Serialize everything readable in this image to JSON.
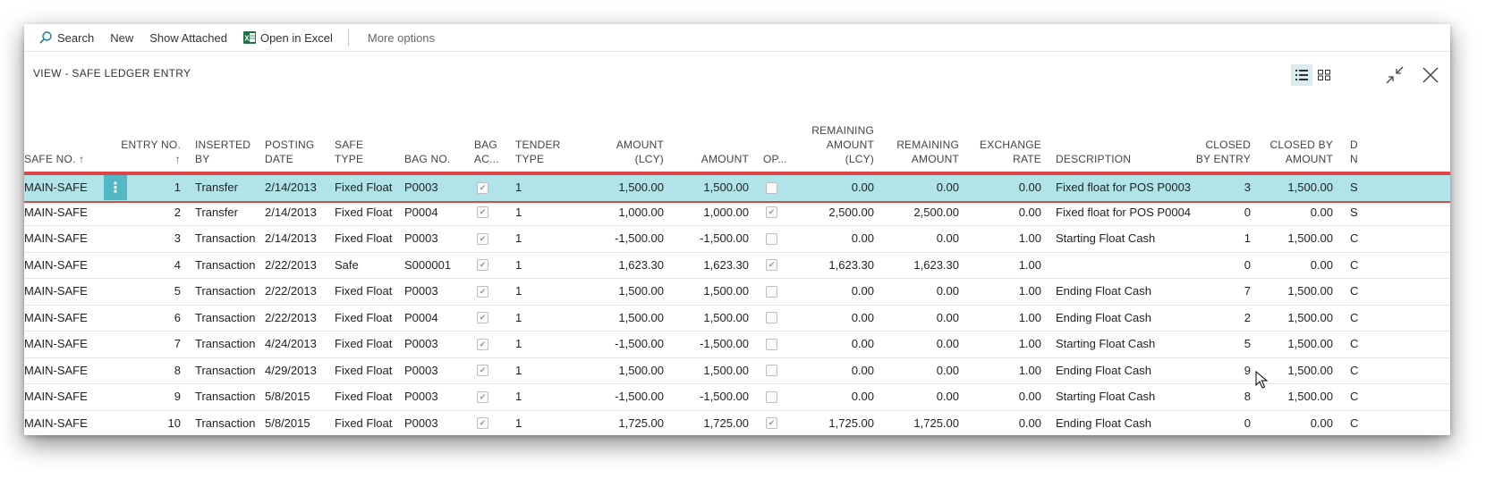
{
  "toolbar": {
    "search": "Search",
    "new": "New",
    "show_attached": "Show Attached",
    "open_in_excel": "Open in Excel",
    "more_options": "More options"
  },
  "view_title": "VIEW - SAFE LEDGER ENTRY",
  "columns": {
    "safe_no": [
      "SAFE NO. ↑"
    ],
    "entry_no": [
      "ENTRY NO.",
      "↑"
    ],
    "inserted_by": [
      "INSERTED",
      "BY"
    ],
    "posting_date": [
      "POSTING",
      "DATE"
    ],
    "safe_type": [
      "SAFE",
      "TYPE"
    ],
    "bag_no": [
      "BAG NO."
    ],
    "bag_ac": [
      "BAG",
      "AC..."
    ],
    "tender_type": [
      "TENDER",
      "TYPE"
    ],
    "amount_lcy": [
      "AMOUNT",
      "(LCY)"
    ],
    "amount": [
      "AMOUNT"
    ],
    "op": [
      "OP..."
    ],
    "remaining_amount_lcy": [
      "REMAINING",
      "AMOUNT",
      "(LCY)"
    ],
    "remaining_amount": [
      "REMAINING",
      "AMOUNT"
    ],
    "exchange_rate": [
      "EXCHANGE",
      "RATE"
    ],
    "description": [
      "DESCRIPTION"
    ],
    "closed_by_entry": [
      "CLOSED",
      "BY ENTRY"
    ],
    "closed_by_amount": [
      "CLOSED BY",
      "AMOUNT"
    ],
    "d_partial": [
      "D",
      "N"
    ]
  },
  "rows": [
    {
      "safe_no": "MAIN-SAFE",
      "entry_no": "1",
      "inserted_by": "Transfer",
      "posting_date": "2/14/2013",
      "safe_type": "Fixed Float",
      "bag_no": "P0003",
      "bag_ac": true,
      "tender_type": "1",
      "amount_lcy": "1,500.00",
      "amount": "1,500.00",
      "op": false,
      "remaining_amount_lcy": "0.00",
      "remaining_amount": "0.00",
      "exchange_rate": "0.00",
      "description": "Fixed float for POS P0003",
      "closed_by_entry": "3",
      "closed_by_amount": "1,500.00",
      "d_partial": "S",
      "selected": true
    },
    {
      "safe_no": "MAIN-SAFE",
      "entry_no": "2",
      "inserted_by": "Transfer",
      "posting_date": "2/14/2013",
      "safe_type": "Fixed Float",
      "bag_no": "P0004",
      "bag_ac": true,
      "tender_type": "1",
      "amount_lcy": "1,000.00",
      "amount": "1,000.00",
      "op": true,
      "remaining_amount_lcy": "2,500.00",
      "remaining_amount": "2,500.00",
      "exchange_rate": "0.00",
      "description": "Fixed float for POS P0004",
      "closed_by_entry": "0",
      "closed_by_amount": "0.00",
      "d_partial": "S"
    },
    {
      "safe_no": "MAIN-SAFE",
      "entry_no": "3",
      "inserted_by": "Transaction",
      "posting_date": "2/14/2013",
      "safe_type": "Fixed Float",
      "bag_no": "P0003",
      "bag_ac": true,
      "tender_type": "1",
      "amount_lcy": "-1,500.00",
      "amount": "-1,500.00",
      "op": false,
      "remaining_amount_lcy": "0.00",
      "remaining_amount": "0.00",
      "exchange_rate": "1.00",
      "description": "Starting Float Cash",
      "closed_by_entry": "1",
      "closed_by_amount": "1,500.00",
      "d_partial": "C"
    },
    {
      "safe_no": "MAIN-SAFE",
      "entry_no": "4",
      "inserted_by": "Transaction",
      "posting_date": "2/22/2013",
      "safe_type": "Safe",
      "bag_no": "S000001",
      "bag_ac": true,
      "tender_type": "1",
      "amount_lcy": "1,623.30",
      "amount": "1,623.30",
      "op": true,
      "remaining_amount_lcy": "1,623.30",
      "remaining_amount": "1,623.30",
      "exchange_rate": "1.00",
      "description": "",
      "closed_by_entry": "0",
      "closed_by_amount": "0.00",
      "d_partial": "C"
    },
    {
      "safe_no": "MAIN-SAFE",
      "entry_no": "5",
      "inserted_by": "Transaction",
      "posting_date": "2/22/2013",
      "safe_type": "Fixed Float",
      "bag_no": "P0003",
      "bag_ac": true,
      "tender_type": "1",
      "amount_lcy": "1,500.00",
      "amount": "1,500.00",
      "op": false,
      "remaining_amount_lcy": "0.00",
      "remaining_amount": "0.00",
      "exchange_rate": "1.00",
      "description": "Ending Float Cash",
      "closed_by_entry": "7",
      "closed_by_amount": "1,500.00",
      "d_partial": "C"
    },
    {
      "safe_no": "MAIN-SAFE",
      "entry_no": "6",
      "inserted_by": "Transaction",
      "posting_date": "2/22/2013",
      "safe_type": "Fixed Float",
      "bag_no": "P0004",
      "bag_ac": true,
      "tender_type": "1",
      "amount_lcy": "1,500.00",
      "amount": "1,500.00",
      "op": false,
      "remaining_amount_lcy": "0.00",
      "remaining_amount": "0.00",
      "exchange_rate": "1.00",
      "description": "Ending Float Cash",
      "closed_by_entry": "2",
      "closed_by_amount": "1,500.00",
      "d_partial": "C"
    },
    {
      "safe_no": "MAIN-SAFE",
      "entry_no": "7",
      "inserted_by": "Transaction",
      "posting_date": "4/24/2013",
      "safe_type": "Fixed Float",
      "bag_no": "P0003",
      "bag_ac": true,
      "tender_type": "1",
      "amount_lcy": "-1,500.00",
      "amount": "-1,500.00",
      "op": false,
      "remaining_amount_lcy": "0.00",
      "remaining_amount": "0.00",
      "exchange_rate": "1.00",
      "description": "Starting Float Cash",
      "closed_by_entry": "5",
      "closed_by_amount": "1,500.00",
      "d_partial": "C"
    },
    {
      "safe_no": "MAIN-SAFE",
      "entry_no": "8",
      "inserted_by": "Transaction",
      "posting_date": "4/29/2013",
      "safe_type": "Fixed Float",
      "bag_no": "P0003",
      "bag_ac": true,
      "tender_type": "1",
      "amount_lcy": "1,500.00",
      "amount": "1,500.00",
      "op": false,
      "remaining_amount_lcy": "0.00",
      "remaining_amount": "0.00",
      "exchange_rate": "1.00",
      "description": "Ending Float Cash",
      "closed_by_entry": "9",
      "closed_by_amount": "1,500.00",
      "d_partial": "C"
    },
    {
      "safe_no": "MAIN-SAFE",
      "entry_no": "9",
      "inserted_by": "Transaction",
      "posting_date": "5/8/2015",
      "safe_type": "Fixed Float",
      "bag_no": "P0003",
      "bag_ac": true,
      "tender_type": "1",
      "amount_lcy": "-1,500.00",
      "amount": "-1,500.00",
      "op": false,
      "remaining_amount_lcy": "0.00",
      "remaining_amount": "0.00",
      "exchange_rate": "0.00",
      "description": "Starting Float Cash",
      "closed_by_entry": "8",
      "closed_by_amount": "1,500.00",
      "d_partial": "C"
    },
    {
      "safe_no": "MAIN-SAFE",
      "entry_no": "10",
      "inserted_by": "Transaction",
      "posting_date": "5/8/2015",
      "safe_type": "Fixed Float",
      "bag_no": "P0003",
      "bag_ac": true,
      "tender_type": "1",
      "amount_lcy": "1,725.00",
      "amount": "1,725.00",
      "op": true,
      "remaining_amount_lcy": "1,725.00",
      "remaining_amount": "1,725.00",
      "exchange_rate": "0.00",
      "description": "Ending Float Cash",
      "closed_by_entry": "0",
      "closed_by_amount": "0.00",
      "d_partial": "C"
    }
  ],
  "icons": {
    "search": "search-icon",
    "excel": "excel-icon",
    "list_view": "list-view-icon",
    "tile_view": "tile-view-icon",
    "collapse": "collapse-icon",
    "close": "close-icon",
    "row_menu": "more-vertical-icon",
    "pointer": "mouse-pointer-icon"
  },
  "colors": {
    "selected_row": "#b1e4e8",
    "row_menu": "#52b9c4",
    "highlight_border": "#e14444",
    "excel_green": "#1e7145"
  }
}
